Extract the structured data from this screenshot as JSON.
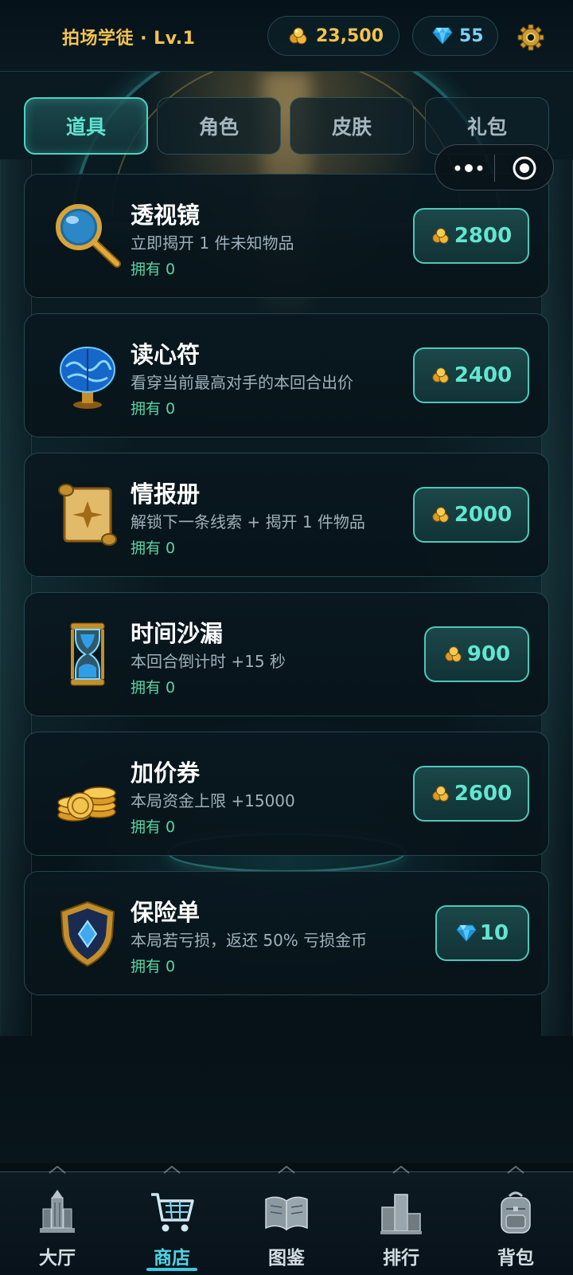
{
  "header": {
    "player_label": "拍场学徒 · Lv.1",
    "gold": "23,500",
    "gems": "55"
  },
  "tabs": [
    {
      "label": "道具",
      "active": true
    },
    {
      "label": "角色",
      "active": false
    },
    {
      "label": "皮肤",
      "active": false
    },
    {
      "label": "礼包",
      "active": false
    }
  ],
  "items": [
    {
      "name": "透视镜",
      "desc": "立即揭开 1 件未知物品",
      "own": "拥有 0",
      "price": "2800",
      "currency": "gold",
      "icon": "magnifier-icon"
    },
    {
      "name": "读心符",
      "desc": "看穿当前最高对手的本回合出价",
      "own": "拥有 0",
      "price": "2400",
      "currency": "gold",
      "icon": "brain-icon"
    },
    {
      "name": "情报册",
      "desc": "解锁下一条线索 + 揭开 1 件物品",
      "own": "拥有 0",
      "price": "2000",
      "currency": "gold",
      "icon": "scroll-icon"
    },
    {
      "name": "时间沙漏",
      "desc": "本回合倒计时 +15 秒",
      "own": "拥有 0",
      "price": "900",
      "currency": "gold",
      "icon": "hourglass-icon"
    },
    {
      "name": "加价券",
      "desc": "本局资金上限 +15000",
      "own": "拥有 0",
      "price": "2600",
      "currency": "gold",
      "icon": "coin-stack-icon"
    },
    {
      "name": "保险单",
      "desc": "本局若亏损，返还 50% 亏损金币",
      "own": "拥有 0",
      "price": "10",
      "currency": "gem",
      "icon": "shield-icon"
    }
  ],
  "nav": [
    {
      "label": "大厅",
      "icon": "hall-icon",
      "active": false
    },
    {
      "label": "商店",
      "icon": "cart-icon",
      "active": true
    },
    {
      "label": "图鉴",
      "icon": "book-icon",
      "active": false
    },
    {
      "label": "排行",
      "icon": "podium-icon",
      "active": false
    },
    {
      "label": "背包",
      "icon": "backpack-icon",
      "active": false
    }
  ],
  "colors": {
    "gold": "#f3c34e",
    "gem": "#79d3ff",
    "accent": "#4fd2c2",
    "owned": "#58d4a4",
    "nav_active": "#4fd6e6"
  }
}
